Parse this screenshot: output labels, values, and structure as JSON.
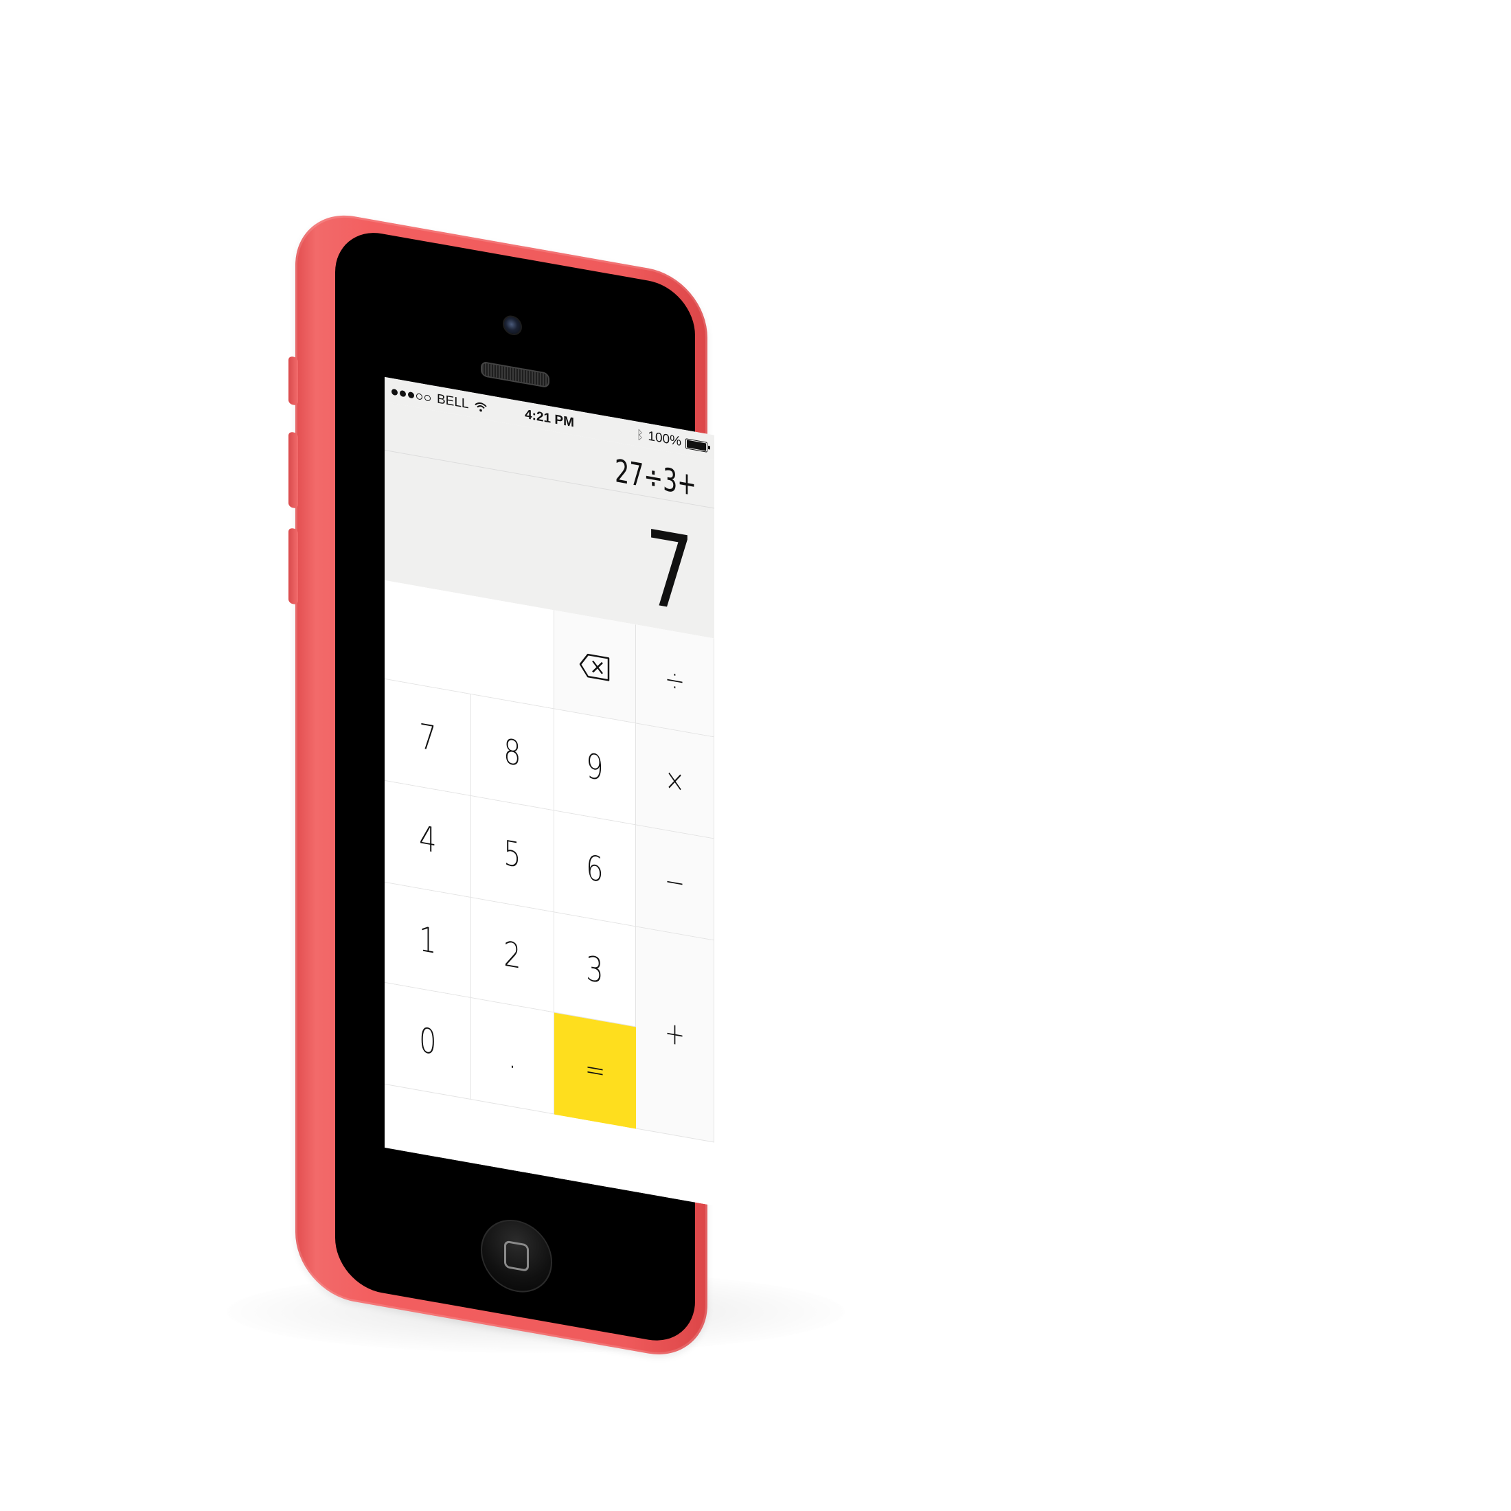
{
  "status_bar": {
    "carrier": "BELL",
    "time": "4:21 PM",
    "battery": "100%",
    "signal_bars_filled": 3,
    "signal_bars_total": 5
  },
  "calculator": {
    "expression": "27÷3+",
    "result": "7"
  },
  "keypad": {
    "row0": {
      "backspace": "backspace-icon",
      "divide": "÷"
    },
    "row1": [
      "7",
      "8",
      "9",
      "×"
    ],
    "row2": [
      "4",
      "5",
      "6",
      "−"
    ],
    "row3": [
      "1",
      "2",
      "3"
    ],
    "plus": "+",
    "row4": [
      "0",
      ".",
      "="
    ]
  },
  "colors": {
    "phone_body": "#f05e5f",
    "equals_key": "#fede1e",
    "display_bg": "#f0f0ef"
  }
}
